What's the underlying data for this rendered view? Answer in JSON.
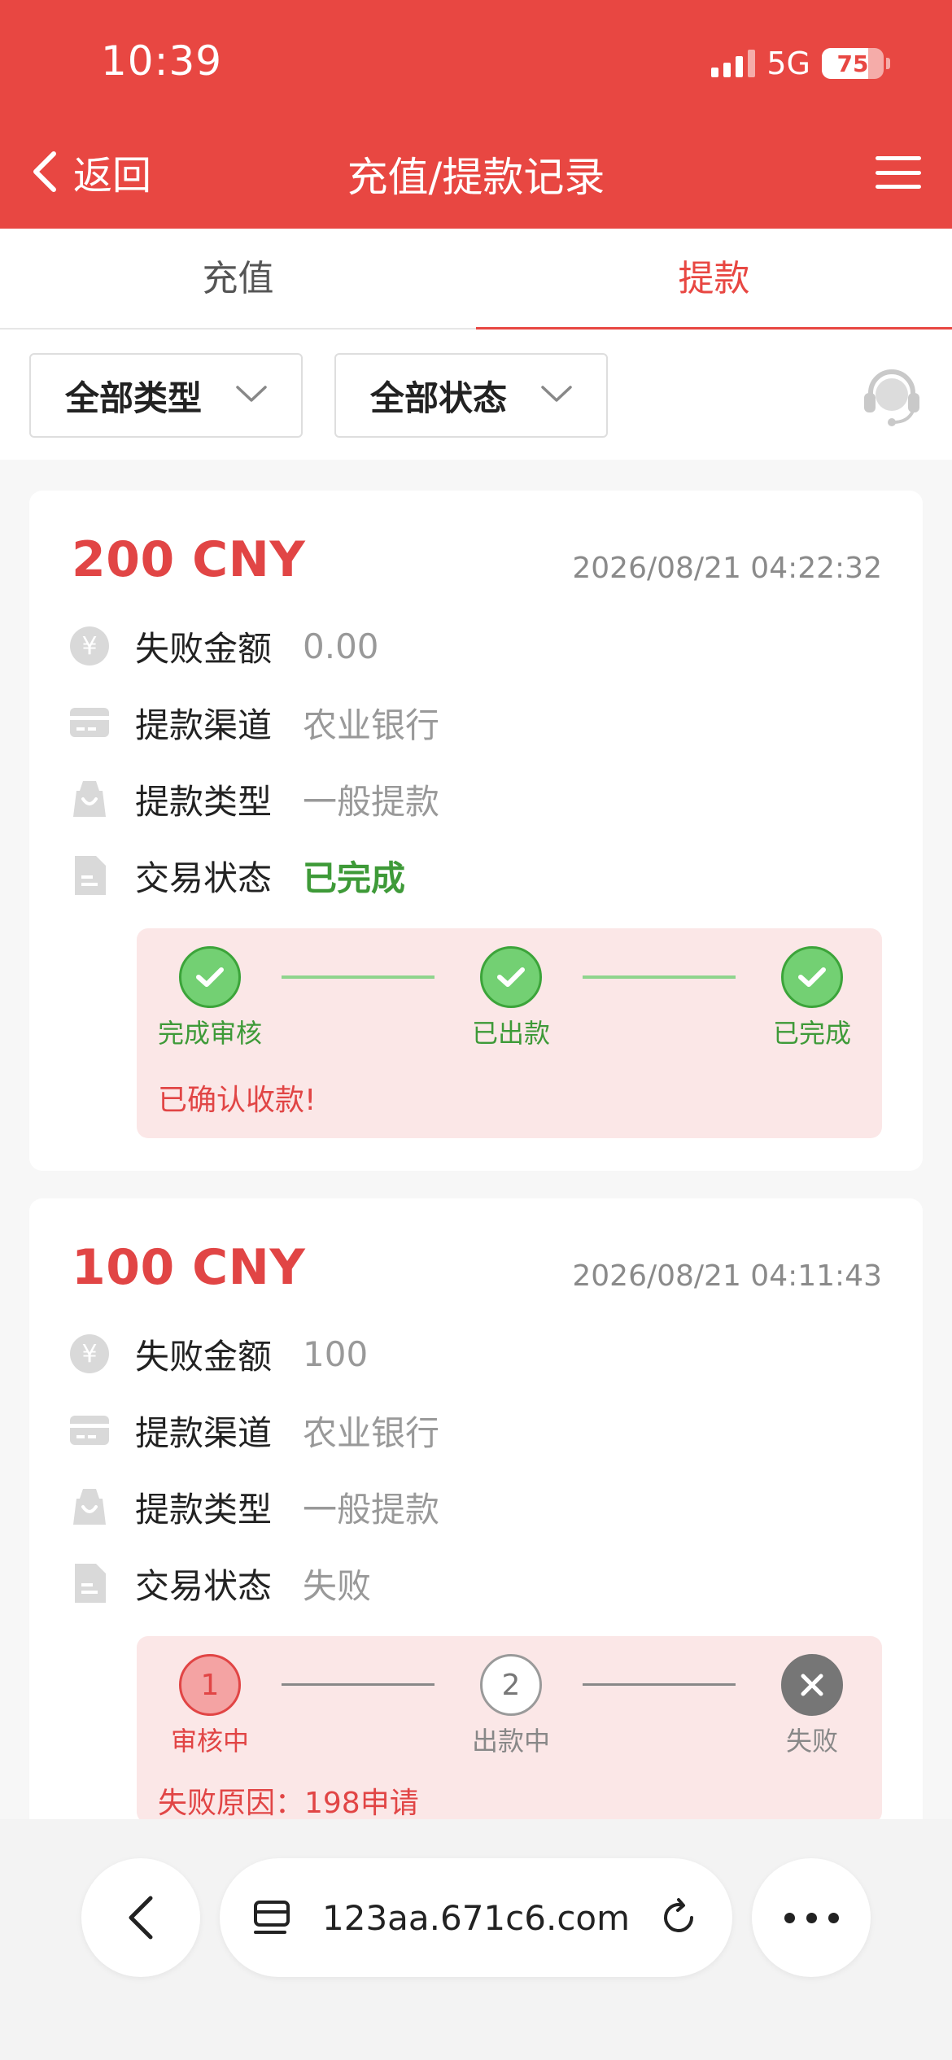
{
  "status_bar": {
    "time": "10:39",
    "network": "5G",
    "battery_level": 75,
    "battery_text": "75"
  },
  "header": {
    "back_label": "返回",
    "title": "充值/提款记录"
  },
  "tabs": [
    {
      "label": "充值",
      "active": false
    },
    {
      "label": "提款",
      "active": true
    }
  ],
  "filters": {
    "type_label": "全部类型",
    "status_label": "全部状态"
  },
  "records": [
    {
      "amount": "200 CNY",
      "datetime": "2026/08/21 04:22:32",
      "fields": [
        {
          "icon": "yen-icon",
          "label": "失败金额",
          "value": "0.00"
        },
        {
          "icon": "card-icon",
          "label": "提款渠道",
          "value": "农业银行"
        },
        {
          "icon": "bag-icon",
          "label": "提款类型",
          "value": "一般提款"
        },
        {
          "icon": "document-icon",
          "label": "交易状态",
          "value": "已完成"
        }
      ],
      "steps": [
        {
          "label": "完成审核",
          "state": "done"
        },
        {
          "label": "已出款",
          "state": "done"
        },
        {
          "label": "已完成",
          "state": "done"
        }
      ],
      "message": "已确认收款!"
    },
    {
      "amount": "100 CNY",
      "datetime": "2026/08/21 04:11:43",
      "fields": [
        {
          "icon": "yen-icon",
          "label": "失败金额",
          "value": "100"
        },
        {
          "icon": "card-icon",
          "label": "提款渠道",
          "value": "农业银行"
        },
        {
          "icon": "bag-icon",
          "label": "提款类型",
          "value": "一般提款"
        },
        {
          "icon": "document-icon",
          "label": "交易状态",
          "value": "失败"
        }
      ],
      "steps": [
        {
          "label": "审核中",
          "number": "1",
          "state": "active"
        },
        {
          "label": "出款中",
          "number": "2",
          "state": "idle"
        },
        {
          "label": "失败",
          "state": "failed"
        }
      ],
      "message": "失败原因：198申请"
    }
  ],
  "browser": {
    "url": "123aa.671c6.com"
  },
  "colors": {
    "brand_red": "#e84742",
    "success_green": "#3e9a38",
    "amount_red": "#e14545"
  }
}
